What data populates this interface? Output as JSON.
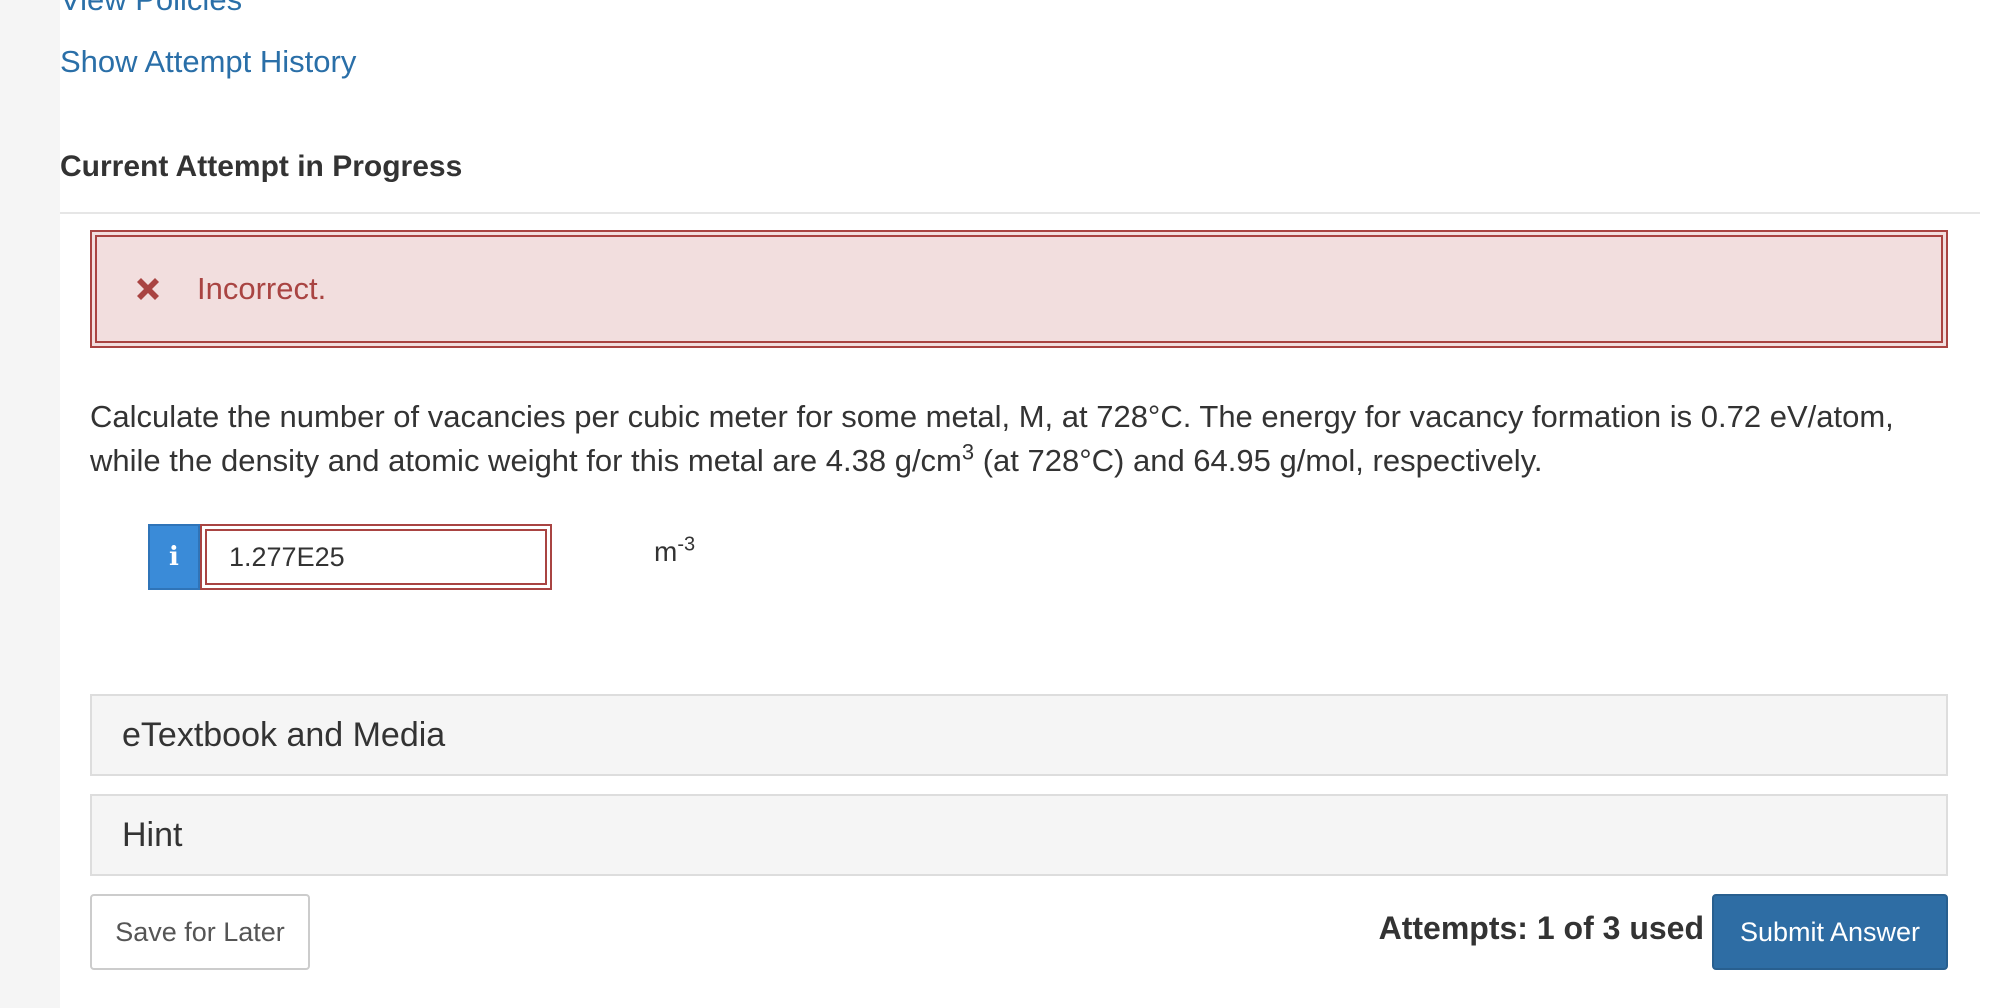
{
  "links": {
    "view_policies": "View Policies",
    "show_attempt_history": "Show Attempt History"
  },
  "section_title": "Current Attempt in Progress",
  "feedback": {
    "icon": "close-icon",
    "text": "Incorrect.",
    "color": "#a94442",
    "background": "#f2dede"
  },
  "question": {
    "line1": "Calculate the number of vacancies per cubic meter for some metal, M, at 728°C. The energy for vacancy formation is 0.72 eV/atom,",
    "line2_pre": "while the density and atomic weight for this metal are 4.38 g/cm",
    "line2_sup": "3",
    "line2_post": " (at 728°C) and 64.95 g/mol, respectively."
  },
  "answer": {
    "info_icon": "info-icon",
    "info_label": "i",
    "value": "1.277E25",
    "unit_base": "m",
    "unit_exp": "-3"
  },
  "panels": {
    "etextbook": "eTextbook and Media",
    "hint": "Hint"
  },
  "footer": {
    "save_label": "Save for Later",
    "attempts_text": "Attempts: 1 of 3 used",
    "submit_label": "Submit Answer"
  },
  "colors": {
    "link": "#2a6fa8",
    "submit": "#2e6da4",
    "info": "#3a8bd8"
  }
}
